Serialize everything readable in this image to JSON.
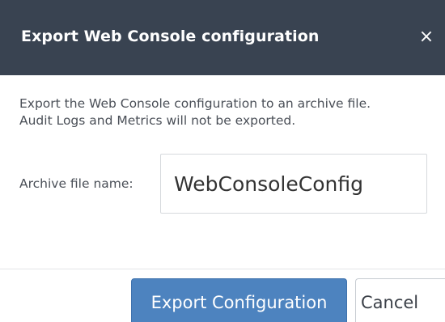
{
  "dialog": {
    "title": "Export Web Console configuration",
    "close_glyph": "×"
  },
  "body": {
    "description_line1": "Export the Web Console configuration to an archive file.",
    "description_line2": "Audit Logs and Metrics will not be exported."
  },
  "form": {
    "archive_label": "Archive file name:",
    "archive_value": "WebConsoleConfig"
  },
  "footer": {
    "export_label": "Export Configuration",
    "cancel_label": "Cancel"
  },
  "colors": {
    "header_bg": "#394351",
    "primary_button": "#4d83bf"
  }
}
